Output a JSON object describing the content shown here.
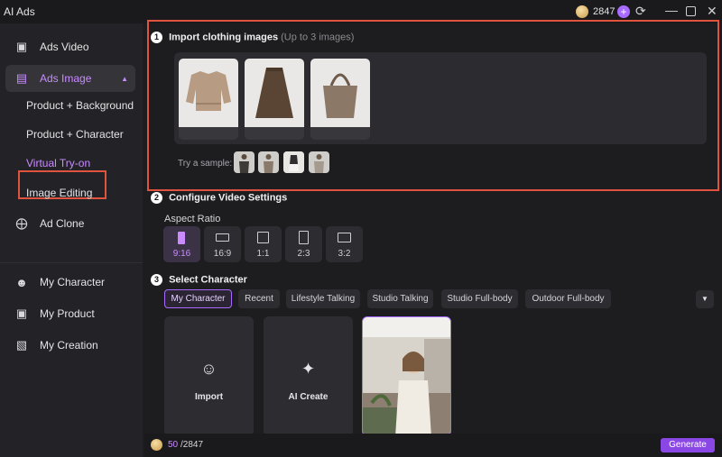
{
  "app": {
    "title": "AI Ads",
    "credits": "2847"
  },
  "sidebar": {
    "items": [
      {
        "label": "Ads Video",
        "icon": "video-bag-icon"
      },
      {
        "label": "Ads Image",
        "icon": "image-icon"
      },
      {
        "label": "Ad Clone",
        "icon": "clone-icon"
      },
      {
        "label": "My Character",
        "icon": "people-icon"
      },
      {
        "label": "My Product",
        "icon": "product-bag-icon"
      },
      {
        "label": "My Creation",
        "icon": "folder-icon"
      }
    ],
    "subitems": [
      "Product + Background",
      "Product + Character",
      "Virtual Try-on",
      "Image Editing"
    ],
    "selected_subitem": "Virtual Try-on"
  },
  "import": {
    "number": "1",
    "title": "Import clothing images",
    "hint": "(Up to 3 images)",
    "sample_label": "Try a sample:",
    "images": [
      "sweater",
      "skirt",
      "tote-bag"
    ]
  },
  "video_settings": {
    "number": "2",
    "title": "Configure Video Settings",
    "aspect_label": "Aspect Ratio",
    "ratios": [
      "9:16",
      "16:9",
      "1:1",
      "2:3",
      "3:2"
    ],
    "selected_ratio": "9:16"
  },
  "character": {
    "number": "3",
    "title": "Select Character",
    "tabs": [
      "My Character",
      "Recent",
      "Lifestyle Talking",
      "Studio Talking",
      "Studio Full-body",
      "Outdoor Full-body"
    ],
    "active_tab": "My Character",
    "cards": [
      {
        "label": "Import",
        "icon": "import-person-icon"
      },
      {
        "label": "AI Create",
        "icon": "ai-create-icon"
      }
    ]
  },
  "footer": {
    "used": "50",
    "total": "/2847",
    "generate_label": "Generate"
  },
  "colors": {
    "accent": "#a86bff",
    "highlight": "#e0533f",
    "background": "#1d1d20"
  }
}
